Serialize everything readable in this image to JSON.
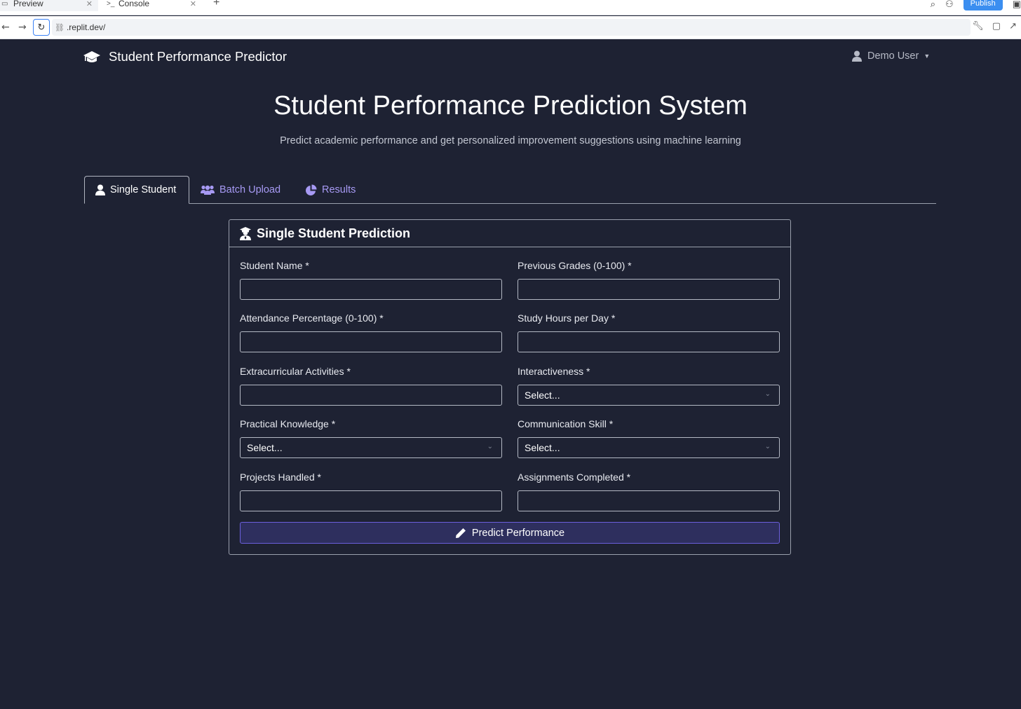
{
  "browser": {
    "tabs": [
      {
        "label": "Preview",
        "icon": "monitor-icon"
      },
      {
        "label": "Console",
        "icon": "terminal-icon"
      }
    ],
    "publish_label": "Publish",
    "url": ".replit.dev/"
  },
  "navbar": {
    "brand": "Student Performance Predictor",
    "user": "Demo User"
  },
  "hero": {
    "title": "Student Performance Prediction System",
    "subtitle": "Predict academic performance and get personalized improvement suggestions using machine learning"
  },
  "tabs": [
    {
      "label": "Single Student",
      "icon": "user-icon",
      "active": true
    },
    {
      "label": "Batch Upload",
      "icon": "users-icon",
      "active": false
    },
    {
      "label": "Results",
      "icon": "pie-chart-icon",
      "active": false
    }
  ],
  "form": {
    "title": "Single Student Prediction",
    "fields": {
      "student_name": {
        "label": "Student Name *",
        "value": ""
      },
      "previous_grades": {
        "label": "Previous Grades (0-100) *",
        "value": ""
      },
      "attendance": {
        "label": "Attendance Percentage (0-100) *",
        "value": ""
      },
      "study_hours": {
        "label": "Study Hours per Day *",
        "value": ""
      },
      "extracurricular": {
        "label": "Extracurricular Activities *",
        "value": ""
      },
      "interactiveness": {
        "label": "Interactiveness *",
        "selected": "Select..."
      },
      "practical_knowledge": {
        "label": "Practical Knowledge *",
        "selected": "Select..."
      },
      "communication_skill": {
        "label": "Communication Skill *",
        "selected": "Select..."
      },
      "projects_handled": {
        "label": "Projects Handled *",
        "value": ""
      },
      "assignments_completed": {
        "label": "Assignments Completed *",
        "value": ""
      }
    },
    "submit_label": "Predict Performance"
  },
  "colors": {
    "background": "#1e2233",
    "accent": "#a79af4",
    "button_bg": "#2e2f5e",
    "button_border": "#6b5fdc"
  }
}
